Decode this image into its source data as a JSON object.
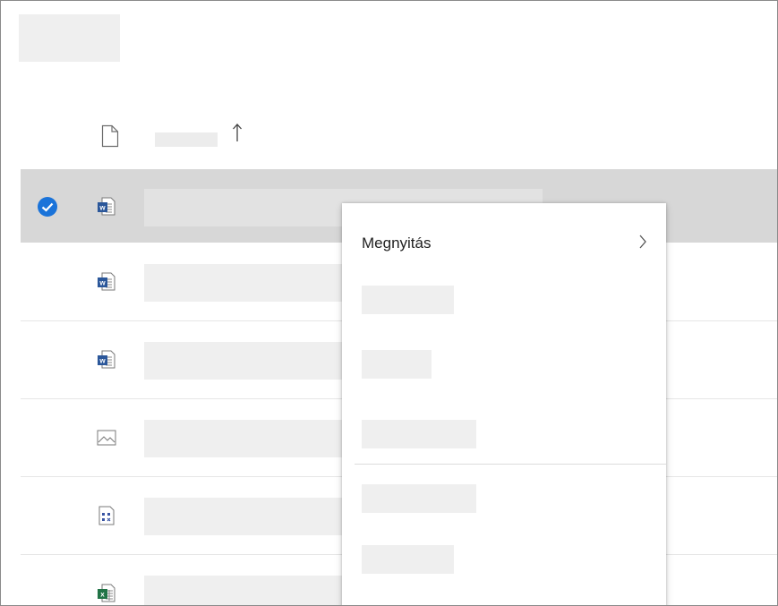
{
  "header": {
    "sort_direction_icon": "arrow-up-icon",
    "file_type_icon": "file-icon"
  },
  "rows": [
    {
      "icon": "word-doc-icon",
      "selected": true
    },
    {
      "icon": "word-doc-icon",
      "selected": false
    },
    {
      "icon": "word-doc-icon",
      "selected": false
    },
    {
      "icon": "image-icon",
      "selected": false
    },
    {
      "icon": "visio-diagram-icon",
      "selected": false
    },
    {
      "icon": "excel-sheet-icon",
      "selected": false
    }
  ],
  "context_menu": {
    "open_label": "Megnyitás",
    "open_submenu_icon": "chevron-right-icon"
  },
  "colors": {
    "selection_background": "#d7d7d7",
    "checkmark_blue": "#1a73d9",
    "word_blue": "#2b579a",
    "excel_green": "#217346",
    "visio_blue": "#3955a3"
  }
}
